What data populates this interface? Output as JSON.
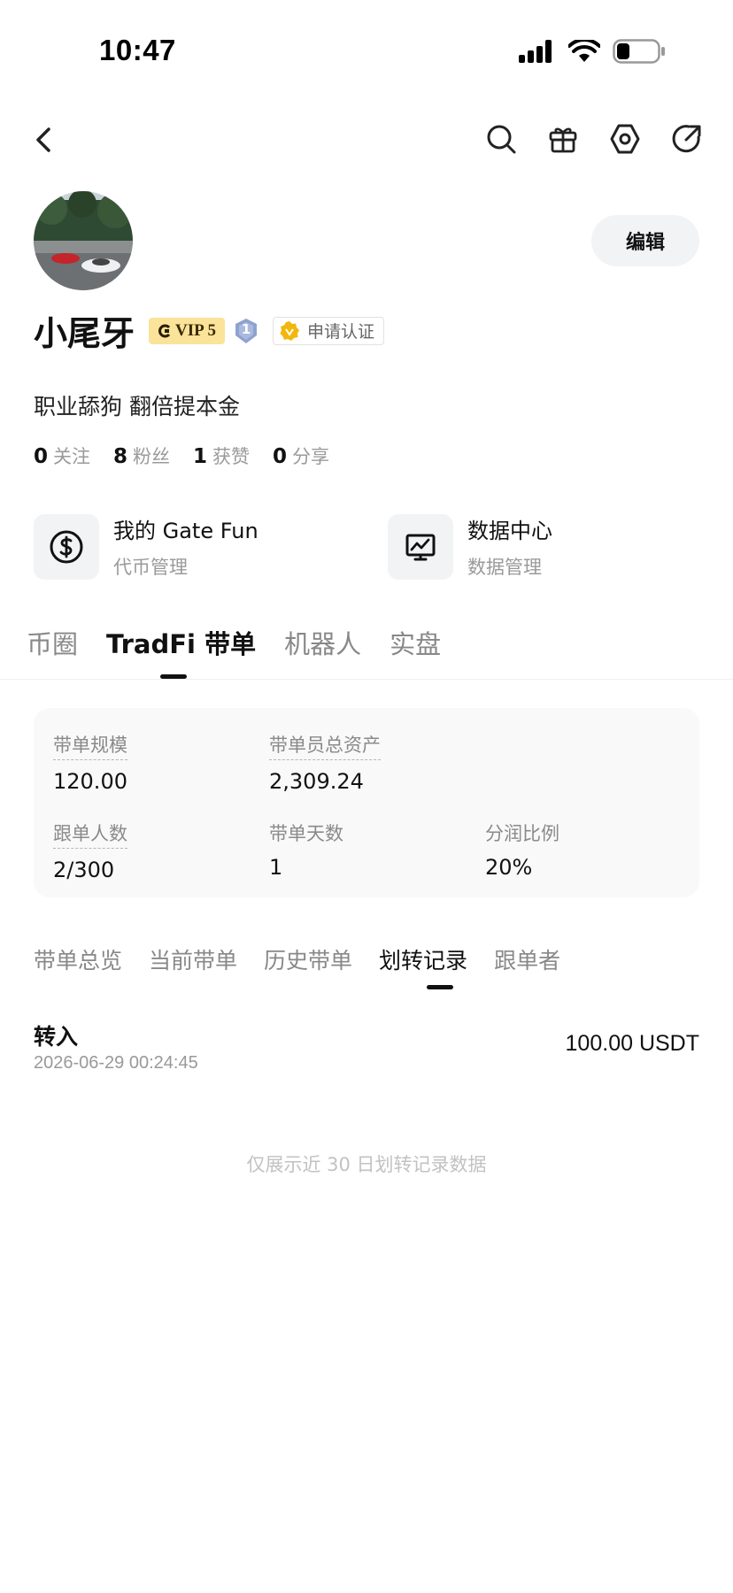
{
  "status_bar": {
    "time": "10:47"
  },
  "profile": {
    "username": "小尾牙",
    "vip_label": "VIP 5",
    "level_label": "1",
    "verify_label": "申请认证",
    "edit_label": "编辑",
    "bio": "职业舔狗 翻倍提本金",
    "stats": [
      {
        "num": "0",
        "label": "关注"
      },
      {
        "num": "8",
        "label": "粉丝"
      },
      {
        "num": "1",
        "label": "获赞"
      },
      {
        "num": "0",
        "label": "分享"
      }
    ]
  },
  "shortcuts": [
    {
      "title": "我的 Gate Fun",
      "subtitle": "代币管理",
      "icon": "dollar-circle-icon"
    },
    {
      "title": "数据中心",
      "subtitle": "数据管理",
      "icon": "chart-monitor-icon"
    }
  ],
  "main_tabs": [
    "币圈",
    "TradFi 带单",
    "机器人",
    "实盘"
  ],
  "main_tab_active": 1,
  "card": {
    "scale_label": "带单规模",
    "scale_value": "120.00",
    "assets_label": "带单员总资产",
    "assets_value": "2,309.24",
    "followers_label": "跟单人数",
    "followers_value": "2/300",
    "days_label": "带单天数",
    "days_value": "1",
    "share_label": "分润比例",
    "share_value": "20%"
  },
  "sub_tabs": [
    "带单总览",
    "当前带单",
    "历史带单",
    "划转记录",
    "跟单者"
  ],
  "sub_tab_active": 3,
  "record": {
    "type": "转入",
    "time": "2026-06-29 00:24:45",
    "amount": "100.00 USDT"
  },
  "footnote": "仅展示近 30 日划转记录数据"
}
